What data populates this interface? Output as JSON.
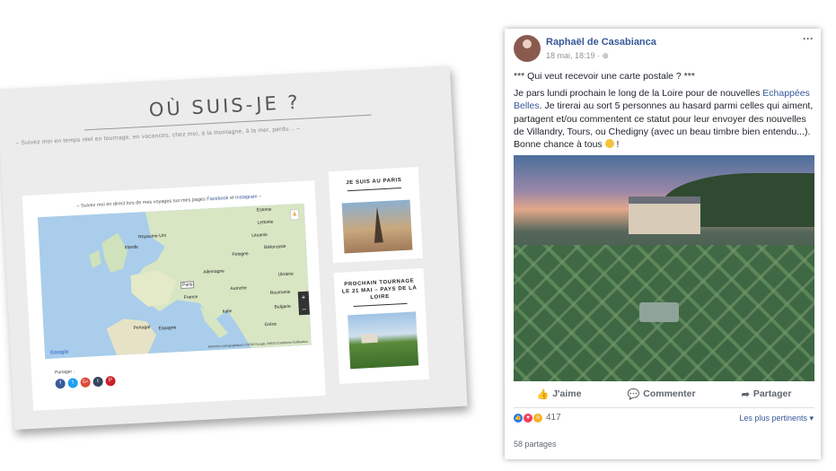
{
  "website": {
    "title": "OÙ SUIS-JE ?",
    "subtitle": "– Suivez moi en temps réel en tournage, en vacances, chez moi, à la montagne, à la mer, perdu… –",
    "map_caption_prefix": "– Suivez moi en direct lors de mes voyages sur mes pages",
    "map_link_facebook": "Facebook",
    "map_caption_and": "et",
    "map_link_instagram": "Instagram",
    "map_caption_suffix": "–",
    "map_labels": [
      "Estonie",
      "Lettonie",
      "Lituanie",
      "Royaume-Uni",
      "Biélorussie",
      "Irlande",
      "Pologne",
      "Allemagne",
      "Ukraine",
      "Paris",
      "France",
      "Autriche",
      "Roumanie",
      "Italie",
      "Bulgarie",
      "Espagne",
      "Portugal",
      "Grèce"
    ],
    "zoom_in": "+",
    "zoom_out": "–",
    "google_logo": "Google",
    "map_attribution": "Données cartographiques ©2018 Google, INEGI  Conditions d'utilisation",
    "share_label": "Partager :",
    "share_icons": [
      "f",
      "t",
      "G+",
      "t",
      "P"
    ],
    "sidebar": {
      "box1_title": "JE SUIS AU PARIS",
      "box2_title": "PROCHAIN TOURNAGE LE 21 MAI – PAYS DE LA LOIRE"
    }
  },
  "facebook_post": {
    "author": "Raphaël de Casabianca",
    "meta": "18 mai, 18:19 · ⊕",
    "more": "···",
    "line1": "*** Qui veut recevoir une carte postale ? ***",
    "body_before_link": "Je pars lundi prochain le long de la Loire pour de nouvelles",
    "body_link": "Echappées Belles",
    "body_after_link": ". Je tirerai au sort 5 personnes au hasard parmi celles qui aiment, partagent et/ou commentent ce statut pour leur envoyer des nouvelles de Villandry, Tours, ou Chedigny (avec un beau timbre bien entendu...). Bonne chance à tous",
    "body_end": "!",
    "actions": {
      "like": "J'aime",
      "comment": "Commenter",
      "share": "Partager"
    },
    "reaction_count": "417",
    "sort_label": "Les plus pertinents ▾",
    "shares": "58 partages",
    "colors": {
      "link": "#365899",
      "text": "#1d2129",
      "muted": "#606770"
    }
  }
}
